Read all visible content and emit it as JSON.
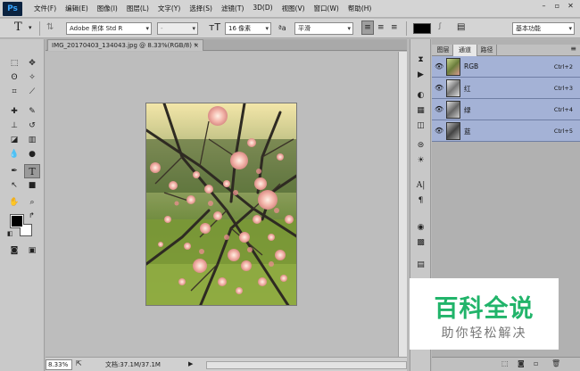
{
  "app": {
    "logo": "Ps"
  },
  "menu": [
    "文件(F)",
    "编辑(E)",
    "图像(I)",
    "图层(L)",
    "文字(Y)",
    "选择(S)",
    "滤镜(T)",
    "3D(D)",
    "视图(V)",
    "窗口(W)",
    "帮助(H)"
  ],
  "window_buttons": {
    "minimize": "–",
    "restore": "▫",
    "close": "✕"
  },
  "options": {
    "font_family": "Adobe 黑体 Std R",
    "font_style": "-",
    "font_size": "16 像素",
    "aa_label": "ªa",
    "antialias": "平滑",
    "workspace": "基本功能",
    "text_color": "#000000"
  },
  "document": {
    "tab_title": "IMG_20170403_134043.jpg @ 8.33%(RGB/8) *",
    "close": "×",
    "zoom": "8.33%",
    "doc_info": "文档:37.1M/37.1M"
  },
  "panel": {
    "tabs": [
      "图层",
      "通道",
      "路径"
    ],
    "active_tab": 1,
    "channels": [
      {
        "name": "RGB",
        "shortcut": "Ctrl+2"
      },
      {
        "name": "红",
        "shortcut": "Ctrl+3"
      },
      {
        "name": "绿",
        "shortcut": "Ctrl+4"
      },
      {
        "name": "蓝",
        "shortcut": "Ctrl+5"
      }
    ]
  },
  "watermark": {
    "title": "百科全说",
    "subtitle": "助你轻松解决"
  },
  "colors": {
    "accent": "#21b46a",
    "selected_row": "#a4b2d6"
  }
}
